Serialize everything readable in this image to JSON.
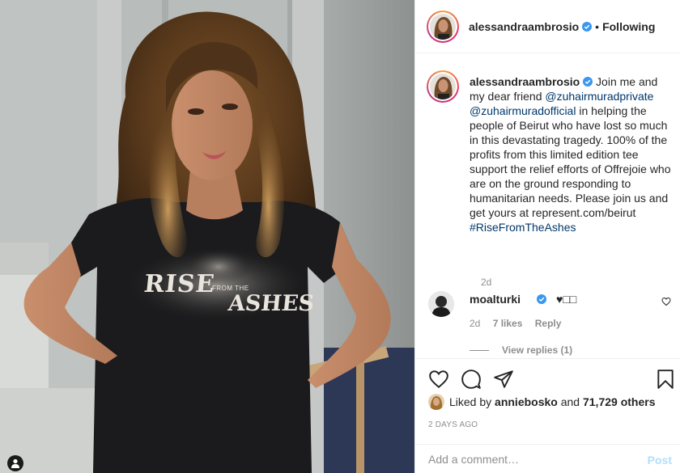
{
  "photo": {
    "shirt_print": {
      "rise": "RISE",
      "from_the": "FROM THE",
      "ashes": "ASHES"
    },
    "tag_icon": "user-icon"
  },
  "post": {
    "author": "alessandraambrosio",
    "verified": true,
    "separator": "•",
    "follow_status": "Following"
  },
  "caption": {
    "username": "alessandraambrosio",
    "text_before": " Join me and my dear friend ",
    "mention1": "@zuhairmuradprivate",
    "space": " ",
    "mention2": "@zuhairmuradofficial",
    "text_after": " in helping the people of Beirut who have lost so much in this devastating tragedy. 100% of the profits from this limited edition tee support the relief efforts of Offrejoie who are on the ground responding to humanitarian needs. Please join us and get yours at represent.com/beirut ",
    "hashtag": "#RiseFromTheAshes",
    "time": "2d"
  },
  "comment": {
    "username": "moalturki",
    "verified": true,
    "text": "♥□□",
    "time": "2d",
    "likes": "7 likes",
    "reply_label": "Reply",
    "view_replies": "View replies (1)",
    "like_icon": "heart-outline-icon"
  },
  "actions": {
    "like_icon": "heart-icon",
    "comment_icon": "comment-icon",
    "share_icon": "send-icon",
    "save_icon": "bookmark-icon"
  },
  "likes": {
    "prefix": "Liked by ",
    "user": "anniebosko",
    "middle": " and ",
    "count": "71,729 others"
  },
  "timestamp": "2 DAYS AGO",
  "add_comment": {
    "placeholder": "Add a comment…",
    "post_label": "Post"
  },
  "colors": {
    "link": "#00376b",
    "verified": "#3897f0",
    "muted": "#8e8e8e",
    "post_disabled": "#b2dffc"
  }
}
